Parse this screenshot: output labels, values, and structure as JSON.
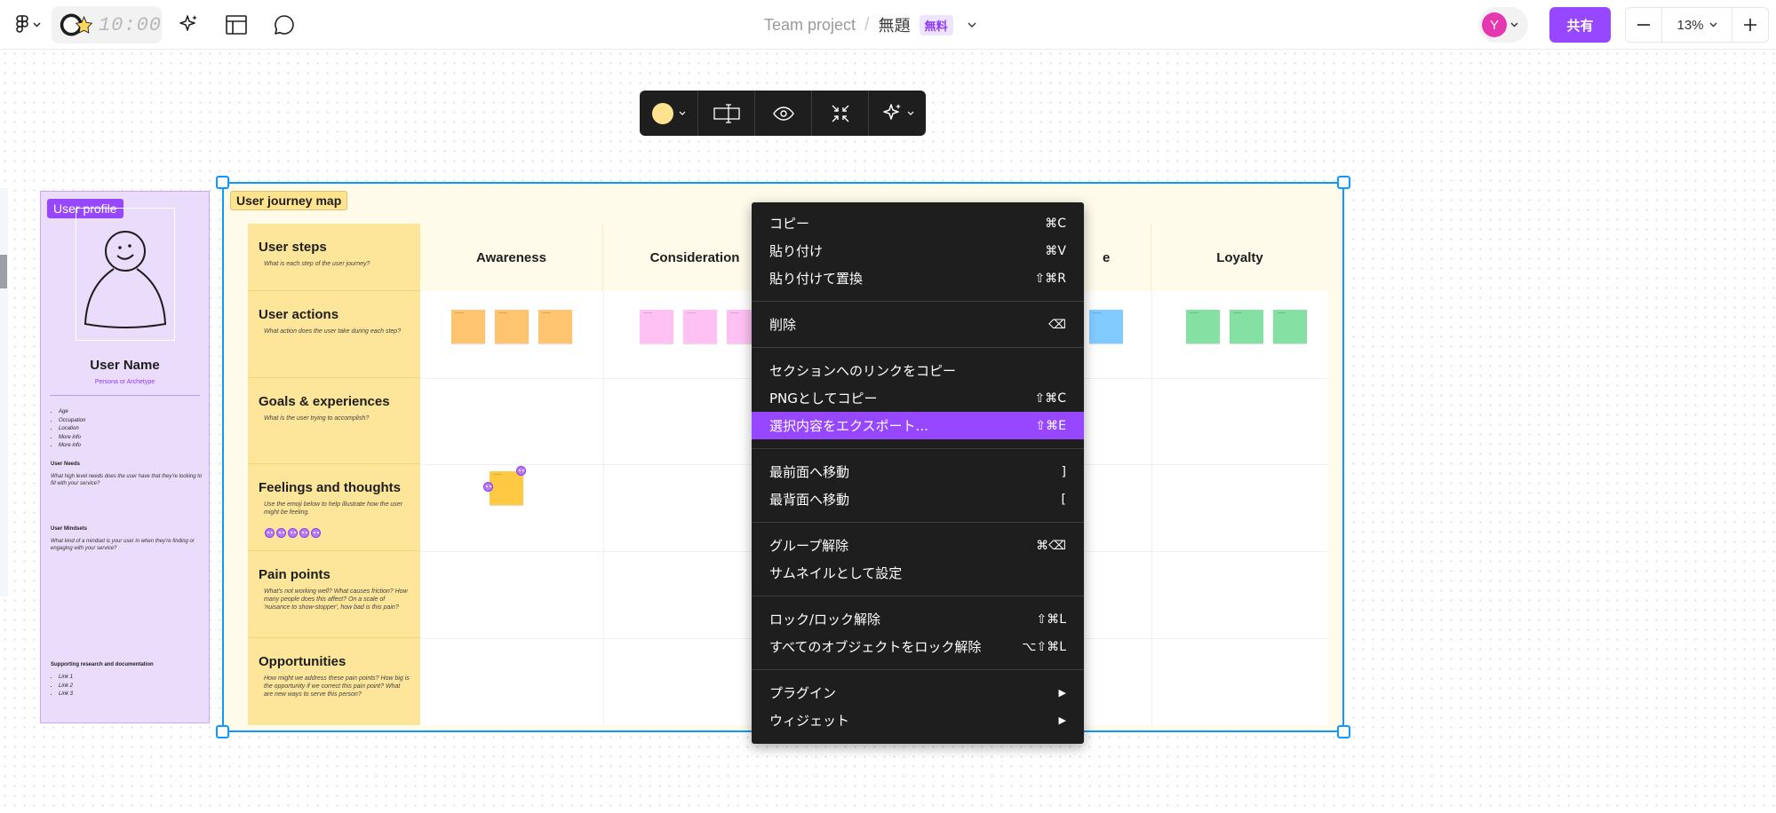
{
  "topbar": {
    "timer": "10:00",
    "project": "Team project",
    "separator": "/",
    "file_name": "無題",
    "plan_badge": "無料",
    "avatar_initial": "Y",
    "share_label": "共有",
    "zoom_value": "13%",
    "zoom_out_symbol": "−",
    "zoom_in_symbol": "+"
  },
  "profile": {
    "tag": "User profile",
    "name": "User Name",
    "subtitle": "Persona or Archetype",
    "attributes": [
      "Age",
      "Occupation",
      "Location",
      "More info",
      "More info"
    ],
    "needs_title": "User Needs",
    "needs_text": "What high level needs does the user have that they're looking to fill with your service?",
    "mindsets_title": "User Mindsets",
    "mindsets_text": "What kind of a mindset is your user in when they're finding or engaging with your service?",
    "research_title": "Supporting research and documentation",
    "links": [
      "Link 1",
      "Link 2",
      "Link 3"
    ]
  },
  "journey": {
    "tag": "User journey map",
    "columns": [
      "Awareness",
      "Consideration",
      "",
      "e",
      "Loyalty"
    ],
    "rows": [
      {
        "title": "User steps",
        "sub": "What is each step of the user journey?"
      },
      {
        "title": "User actions",
        "sub": "What action does the user take during each step?"
      },
      {
        "title": "Goals & experiences",
        "sub": "What is the user trying to accomplish?"
      },
      {
        "title": "Feelings and thoughts",
        "sub": "Use the emoji below to help illustrate how the user might be feeling."
      },
      {
        "title": "Pain points",
        "sub": "What's not working well? What causes friction? How many people does this affect? On a scale of 'nuisance to show-stopper', how bad is this pain?"
      },
      {
        "title": "Opportunities",
        "sub": "How might we address these pain points? How big is the opportunity if we correct this pain point? What are new ways to serve this person?"
      }
    ]
  },
  "context_menu": {
    "groups": [
      [
        {
          "label": "コピー",
          "shortcut": "⌘C"
        },
        {
          "label": "貼り付け",
          "shortcut": "⌘V"
        },
        {
          "label": "貼り付けて置換",
          "shortcut": "⇧⌘R"
        }
      ],
      [
        {
          "label": "削除",
          "shortcut": "⌫"
        }
      ],
      [
        {
          "label": "セクションへのリンクをコピー",
          "shortcut": ""
        },
        {
          "label": "PNGとしてコピー",
          "shortcut": "⇧⌘C"
        },
        {
          "label": "選択内容をエクスポート...",
          "shortcut": "⇧⌘E",
          "active": true
        }
      ],
      [
        {
          "label": "最前面へ移動",
          "shortcut": "]"
        },
        {
          "label": "最背面へ移動",
          "shortcut": "["
        }
      ],
      [
        {
          "label": "グループ解除",
          "shortcut": "⌘⌫"
        },
        {
          "label": "サムネイルとして設定",
          "shortcut": ""
        }
      ],
      [
        {
          "label": "ロック/ロック解除",
          "shortcut": "⇧⌘L"
        },
        {
          "label": "すべてのオブジェクトをロック解除",
          "shortcut": "⌥⇧⌘L"
        }
      ],
      [
        {
          "label": "プラグイン",
          "shortcut": "▶"
        },
        {
          "label": "ウィジェット",
          "shortcut": "▶"
        }
      ]
    ]
  },
  "colors": {
    "accent": "#9747ff",
    "selection": "#0d99ff",
    "sticky_orange": "#ffc470",
    "sticky_pink": "#ffc1f3",
    "sticky_blue": "#80caff",
    "sticky_green": "#85e0a3",
    "sticky_yellow": "#ffc943"
  }
}
